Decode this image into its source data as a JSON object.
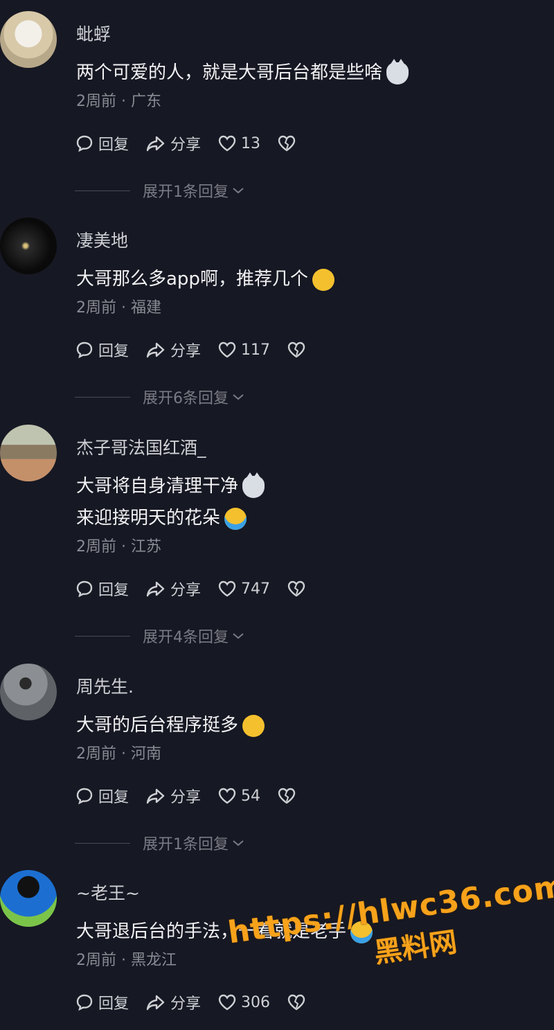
{
  "comments": [
    {
      "username": "蚍蜉",
      "lines": [
        "两个可爱的人，就是大哥后台都是些啥"
      ],
      "emoji": [
        "cat-emoji"
      ],
      "time": "2周前 · 广东",
      "reply_label": "回复",
      "share_label": "分享",
      "likes": "13",
      "expand_label": "展开1条回复"
    },
    {
      "username": "凄美地",
      "lines": [
        "大哥那么多app啊，推荐几个"
      ],
      "emoji": [
        "thinking-emoji"
      ],
      "time": "2周前 · 福建",
      "reply_label": "回复",
      "share_label": "分享",
      "likes": "117",
      "expand_label": "展开6条回复"
    },
    {
      "username": "杰子哥法国红酒_",
      "lines": [
        "大哥将自身清理干净",
        "来迎接明天的花朵"
      ],
      "emoji": [
        "cat-emoji",
        "laugh-cry-emoji"
      ],
      "time": "2周前 · 江苏",
      "reply_label": "回复",
      "share_label": "分享",
      "likes": "747",
      "expand_label": "展开4条回复"
    },
    {
      "username": "周先生.",
      "lines": [
        "大哥的后台程序挺多"
      ],
      "emoji": [
        "smirk-emoji"
      ],
      "time": "2周前 · 河南",
      "reply_label": "回复",
      "share_label": "分享",
      "likes": "54",
      "expand_label": "展开1条回复"
    },
    {
      "username": "~老王~",
      "lines": [
        "大哥退后台的手法，一看就是老手"
      ],
      "emoji": [
        "laugh-cry-emoji"
      ],
      "time": "2周前 · 黑龙江",
      "reply_label": "回复",
      "share_label": "分享",
      "likes": "306",
      "expand_label": ""
    }
  ],
  "watermark": {
    "url": "https://hlwc36.com",
    "name": "黑料网"
  }
}
